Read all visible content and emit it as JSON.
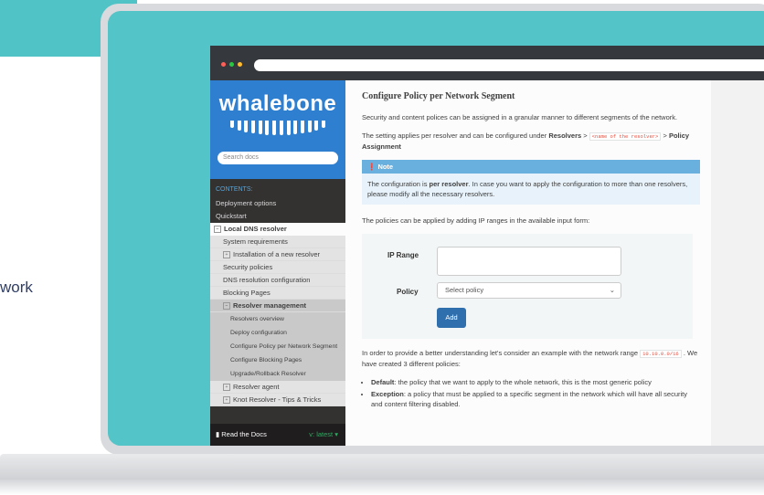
{
  "outside": {
    "side_text": "work"
  },
  "sidebar": {
    "logo": "whalebone",
    "search_placeholder": "Search docs",
    "caption": "CONTENTS:",
    "items": [
      {
        "label": "Deployment options"
      },
      {
        "label": "Quickstart"
      },
      {
        "label": "Local DNS resolver"
      },
      {
        "label": "System requirements"
      },
      {
        "label": "Installation of a new resolver"
      },
      {
        "label": "Security policies"
      },
      {
        "label": "DNS resolution configuration"
      },
      {
        "label": "Blocking Pages"
      },
      {
        "label": "Resolver management"
      },
      {
        "label": "Resolvers overview"
      },
      {
        "label": "Deploy configuration"
      },
      {
        "label": "Configure Policy per Network Segment"
      },
      {
        "label": "Configure Blocking Pages"
      },
      {
        "label": "Upgrade/Rollback Resolver"
      },
      {
        "label": "Resolver agent"
      },
      {
        "label": "Knot Resolver - Tips & Tricks"
      }
    ],
    "footer_label": "Read the Docs",
    "version": "v: latest"
  },
  "content": {
    "title": "Configure Policy per Network Segment",
    "intro": "Security and content polices can be assigned in a granular manner to different segments of the network.",
    "setting_prefix": "The setting applies per resolver and can be configured under",
    "setting_resolvers": "Resolvers",
    "setting_gt1": ">",
    "setting_code": "<name of the resolver>",
    "setting_gt2": ">",
    "setting_policy": "Policy Assignment",
    "note_title": "Note",
    "note_pre": "The configuration is",
    "note_bold": "per resolver",
    "note_post": ". In case you want to apply the configuration to more than one resolvers, please modify all the necessary resolvers.",
    "policies_text": "The policies can be applied by adding IP ranges in the available input form:",
    "form": {
      "ip_label": "IP Range",
      "ip_value": "",
      "policy_label": "Policy",
      "policy_selected": "Select policy",
      "add_label": "Add"
    },
    "example_text": "In order to provide a better understanding let's consider an example with the network range",
    "example_code": "10.10.0.0/16",
    "example_post": ". We have created 3 different policies:",
    "list": [
      {
        "bold": "Default",
        "text": ": the policy that we want to apply to the whole network, this is the most generic policy"
      },
      {
        "bold": "Exception",
        "text": ": a policy that must be applied to a specific segment in the network which will have all security and content filtering disabled."
      }
    ]
  },
  "colors": {
    "teal": "#53c4c7",
    "brand_blue": "#2f7fd0",
    "sidebar_dark": "#343131",
    "note_blue": "#6ab0de"
  }
}
